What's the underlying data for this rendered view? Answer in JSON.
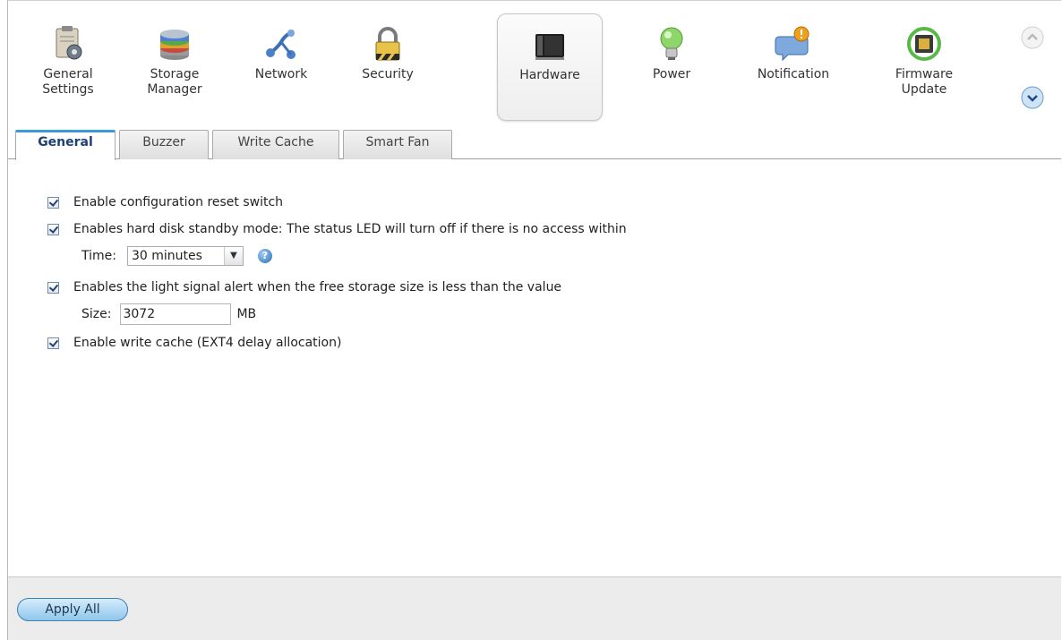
{
  "nav": {
    "items": [
      {
        "label": "General\nSettings",
        "icon": "general-settings-icon"
      },
      {
        "label": "Storage\nManager",
        "icon": "storage-manager-icon"
      },
      {
        "label": "Network",
        "icon": "network-icon"
      },
      {
        "label": "Security",
        "icon": "lock-icon"
      },
      {
        "label": "Hardware",
        "icon": "hardware-icon",
        "active": true
      },
      {
        "label": "Power",
        "icon": "lightbulb-icon"
      },
      {
        "label": "Notification",
        "icon": "notification-icon"
      },
      {
        "label": "Firmware\nUpdate",
        "icon": "firmware-update-icon"
      }
    ],
    "scroll_up_icon": "chevron-up-icon",
    "scroll_down_icon": "chevron-down-icon"
  },
  "tabs": [
    {
      "label": "General",
      "active": true
    },
    {
      "label": "Buzzer"
    },
    {
      "label": "Write Cache"
    },
    {
      "label": "Smart Fan"
    }
  ],
  "settings": {
    "reset_switch": {
      "checked": true,
      "label": "Enable configuration reset switch"
    },
    "standby": {
      "checked": true,
      "label": "Enables hard disk standby mode: The status LED will turn off if there is no access within",
      "time_label": "Time:",
      "time_value": "30 minutes"
    },
    "light_alert": {
      "checked": true,
      "label": "Enables the light signal alert when the free storage size is less than the value",
      "size_label": "Size:",
      "size_value": "3072",
      "size_unit": "MB"
    },
    "write_cache": {
      "checked": true,
      "label": "Enable write cache (EXT4 delay allocation)"
    }
  },
  "footer": {
    "apply_label": "Apply All"
  },
  "colors": {
    "accent": "#3b9ad8",
    "active_tab_text": "#1c3f7a",
    "button": "#8fc6ec"
  }
}
